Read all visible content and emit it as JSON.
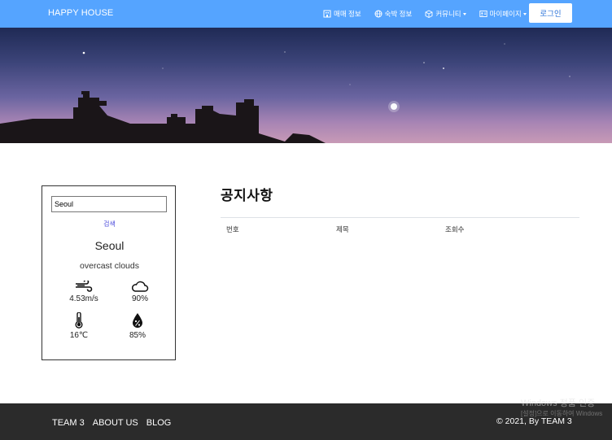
{
  "navbar": {
    "brand": "HAPPY HOUSE",
    "items": [
      {
        "label": "매매 정보",
        "icon": "building-icon",
        "dropdown": false
      },
      {
        "label": "숙박 정보",
        "icon": "globe-icon",
        "dropdown": false
      },
      {
        "label": "커뮤니티",
        "icon": "box-icon",
        "dropdown": true
      },
      {
        "label": "마이페이지",
        "icon": "person-card-icon",
        "dropdown": true
      }
    ],
    "login_label": "로그인"
  },
  "weather": {
    "input_value": "Seoul",
    "search_label": "검색",
    "city": "Seoul",
    "description": "overcast clouds",
    "wind": "4.53m/s",
    "clouds": "90%",
    "temperature": "16℃",
    "humidity": "85%"
  },
  "notice": {
    "title": "공지사항",
    "columns": [
      "번호",
      "제목",
      "조회수"
    ]
  },
  "footer": {
    "links": [
      "TEAM 3",
      "ABOUT US",
      "BLOG"
    ],
    "copyright": "© 2021, By TEAM 3"
  },
  "watermark": {
    "line1": "Windows 정품 인증",
    "line2": "[설정]으로 이동하여 Windows"
  },
  "colors": {
    "navbar": "#55a4ff",
    "footer": "#2b2b2b",
    "search_link": "#4a4adb"
  }
}
